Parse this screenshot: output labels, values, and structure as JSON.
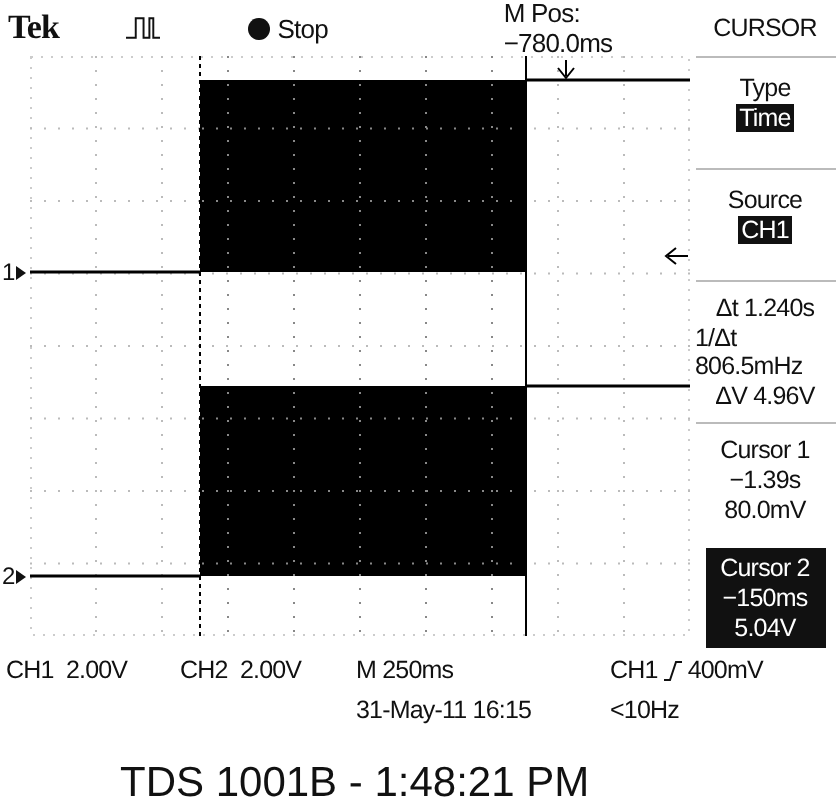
{
  "header": {
    "brand": "Tek",
    "run_state": "Stop",
    "position": "M Pos: −780.0ms"
  },
  "channel_markers": [
    "1",
    "2"
  ],
  "menu": {
    "title": "CURSOR",
    "items": [
      {
        "kind": "option",
        "label": "Type",
        "value": "Time"
      },
      {
        "kind": "option",
        "label": "Source",
        "value": "CH1"
      },
      {
        "kind": "readout",
        "lines": [
          "Δt 1.240s",
          "1/Δt 806.5mHz",
          "ΔV 4.96V"
        ]
      },
      {
        "kind": "cursor",
        "label": "Cursor 1",
        "lines": [
          "−1.39s",
          "80.0mV"
        ],
        "selected": false
      },
      {
        "kind": "cursor",
        "label": "Cursor 2",
        "lines": [
          "−150ms",
          "5.04V"
        ],
        "selected": true
      }
    ]
  },
  "status": {
    "ch1": "CH1  2.00V",
    "ch2": "CH2  2.00V",
    "timebase": "M 250ms",
    "date": "31-May-11 16:15",
    "trigger_source": "CH1",
    "trigger_level": "400mV",
    "trigger_freq": "<10Hz"
  },
  "caption": "TDS 1001B - 1:48:21 PM"
}
